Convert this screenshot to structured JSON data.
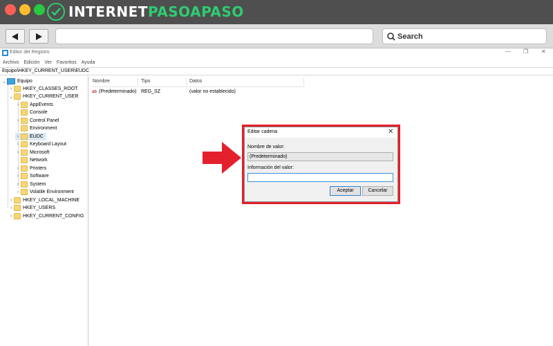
{
  "browser": {
    "logo": {
      "part1": "INTERNET",
      "part2": "PASOAPASO"
    },
    "search_label": "Search",
    "colors": {
      "chrome_dark": "#4f4f4f",
      "brand_green": "#2ecc71",
      "accent_red": "#e3202b"
    }
  },
  "regedit": {
    "title": "Editor del Registro",
    "window_controls": {
      "minimize": "—",
      "maximize": "❐",
      "close": "✕"
    },
    "menu": [
      "Archivo",
      "Edición",
      "Ver",
      "Favoritos",
      "Ayuda"
    ],
    "address": "Equipo\\HKEY_CURRENT_USER\\EUDC",
    "tree": {
      "root": "Equipo",
      "hives": {
        "classes_root": "HKEY_CLASSES_ROOT",
        "current_user": "HKEY_CURRENT_USER",
        "local_machine": "HKEY_LOCAL_MACHINE",
        "users": "HKEY_USERS",
        "current_config": "HKEY_CURRENT_CONFIG"
      },
      "current_user_children": [
        "AppEvents",
        "Console",
        "Control Panel",
        "Environment",
        "EUDC",
        "Keyboard Layout",
        "Microsoft",
        "Network",
        "Printers",
        "Software",
        "System",
        "Volatile Environment"
      ],
      "selected": "EUDC"
    },
    "list": {
      "columns": [
        "Nombre",
        "Tipo",
        "Datos"
      ],
      "rows": [
        {
          "name": "(Predeterminado)",
          "type": "REG_SZ",
          "data": "(valor no establecido)"
        }
      ]
    }
  },
  "dialog": {
    "title": "Editar cadena",
    "close": "✕",
    "value_name_label": "Nombre de valor:",
    "value_name": "(Predeterminado)",
    "value_data_label": "Información del valor:",
    "value_data": "",
    "ok_label": "Aceptar",
    "cancel_label": "Cancelar"
  }
}
